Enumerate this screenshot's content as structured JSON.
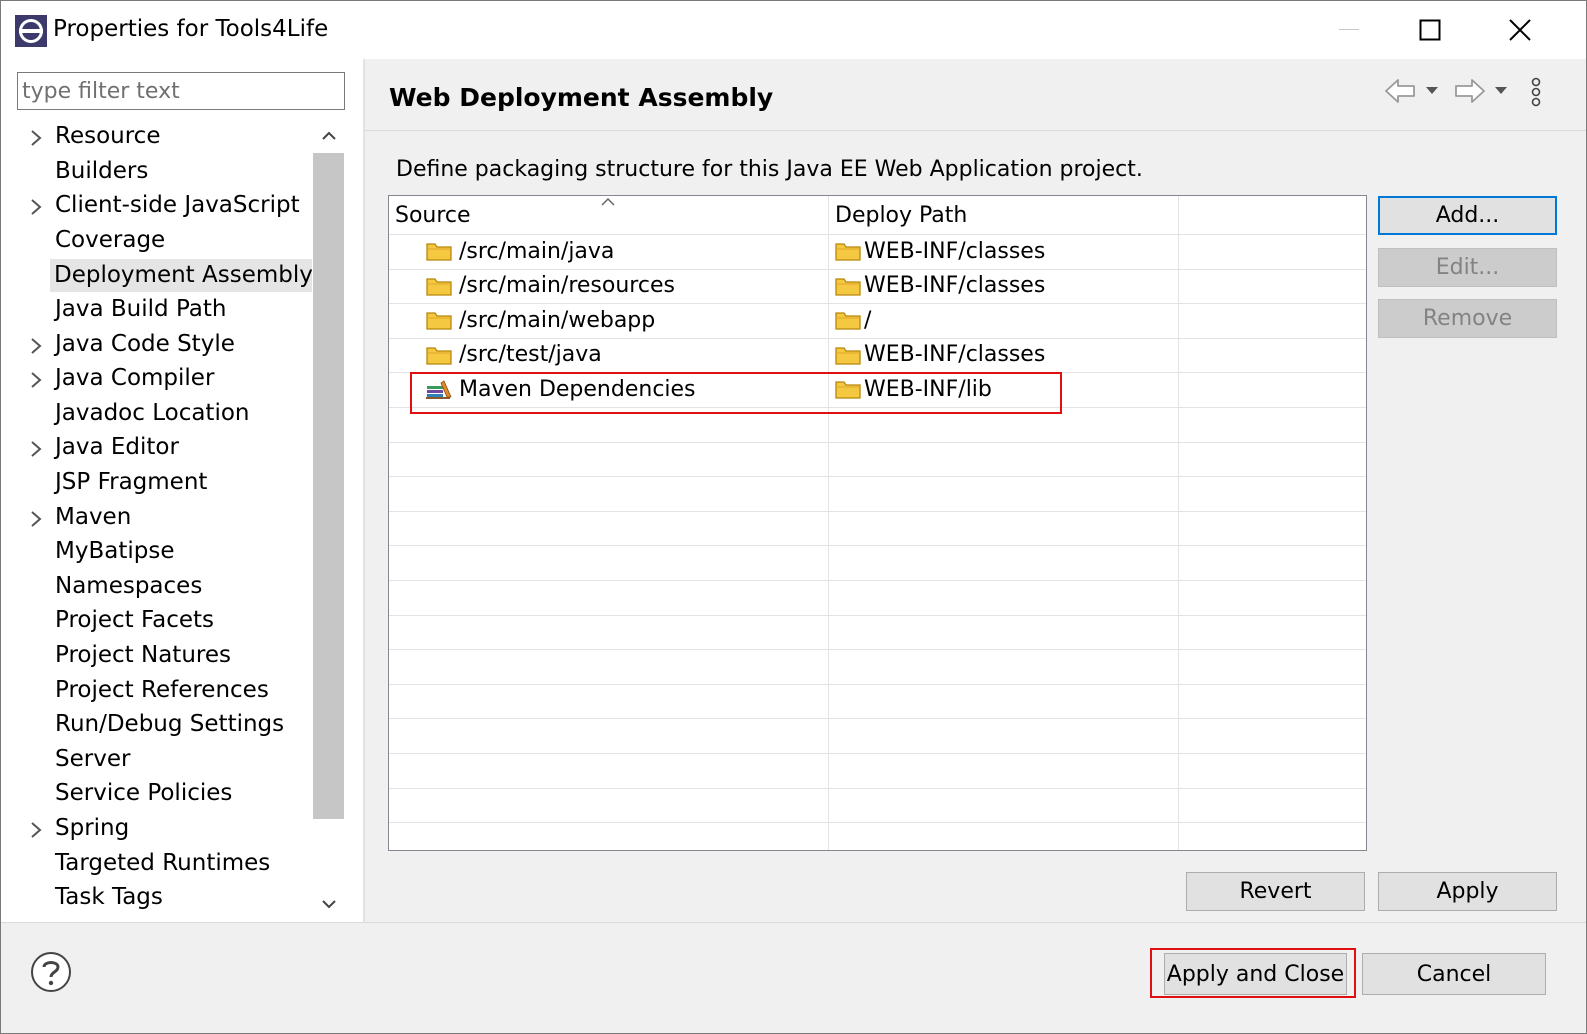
{
  "window": {
    "title": "Properties for Tools4Life"
  },
  "filter": {
    "placeholder": "type filter text"
  },
  "tree": {
    "items": [
      {
        "label": "Resource",
        "expandable": true
      },
      {
        "label": "Builders",
        "expandable": false
      },
      {
        "label": "Client-side JavaScript",
        "expandable": true
      },
      {
        "label": "Coverage",
        "expandable": false
      },
      {
        "label": "Deployment Assembly",
        "expandable": false,
        "selected": true
      },
      {
        "label": "Java Build Path",
        "expandable": false
      },
      {
        "label": "Java Code Style",
        "expandable": true
      },
      {
        "label": "Java Compiler",
        "expandable": true
      },
      {
        "label": "Javadoc Location",
        "expandable": false
      },
      {
        "label": "Java Editor",
        "expandable": true
      },
      {
        "label": "JSP Fragment",
        "expandable": false
      },
      {
        "label": "Maven",
        "expandable": true
      },
      {
        "label": "MyBatipse",
        "expandable": false
      },
      {
        "label": "Namespaces",
        "expandable": false
      },
      {
        "label": "Project Facets",
        "expandable": false
      },
      {
        "label": "Project Natures",
        "expandable": false
      },
      {
        "label": "Project References",
        "expandable": false
      },
      {
        "label": "Run/Debug Settings",
        "expandable": false
      },
      {
        "label": "Server",
        "expandable": false
      },
      {
        "label": "Service Policies",
        "expandable": false
      },
      {
        "label": "Spring",
        "expandable": true
      },
      {
        "label": "Targeted Runtimes",
        "expandable": false
      },
      {
        "label": "Task Tags",
        "expandable": false
      }
    ]
  },
  "page": {
    "title": "Web Deployment Assembly",
    "description": "Define packaging structure for this Java EE Web Application project."
  },
  "table": {
    "columns": [
      "Source",
      "Deploy Path"
    ],
    "rows": [
      {
        "source": "/src/main/java",
        "source_icon": "folder-icon",
        "deploy": "WEB-INF/classes"
      },
      {
        "source": "/src/main/resources",
        "source_icon": "folder-icon",
        "deploy": "WEB-INF/classes"
      },
      {
        "source": "/src/main/webapp",
        "source_icon": "folder-icon",
        "deploy": "/"
      },
      {
        "source": "/src/test/java",
        "source_icon": "folder-icon",
        "deploy": "WEB-INF/classes"
      },
      {
        "source": "Maven Dependencies",
        "source_icon": "library-icon",
        "deploy": "WEB-INF/lib",
        "highlighted": true
      }
    ]
  },
  "buttons": {
    "add": "Add...",
    "edit": "Edit...",
    "remove": "Remove",
    "revert": "Revert",
    "apply": "Apply",
    "apply_and_close": "Apply and Close",
    "cancel": "Cancel"
  },
  "colors": {
    "highlight": "#e01010",
    "selection": "#e5e5e5",
    "default_button_border": "#0078d7",
    "folder": "#f5c842"
  }
}
